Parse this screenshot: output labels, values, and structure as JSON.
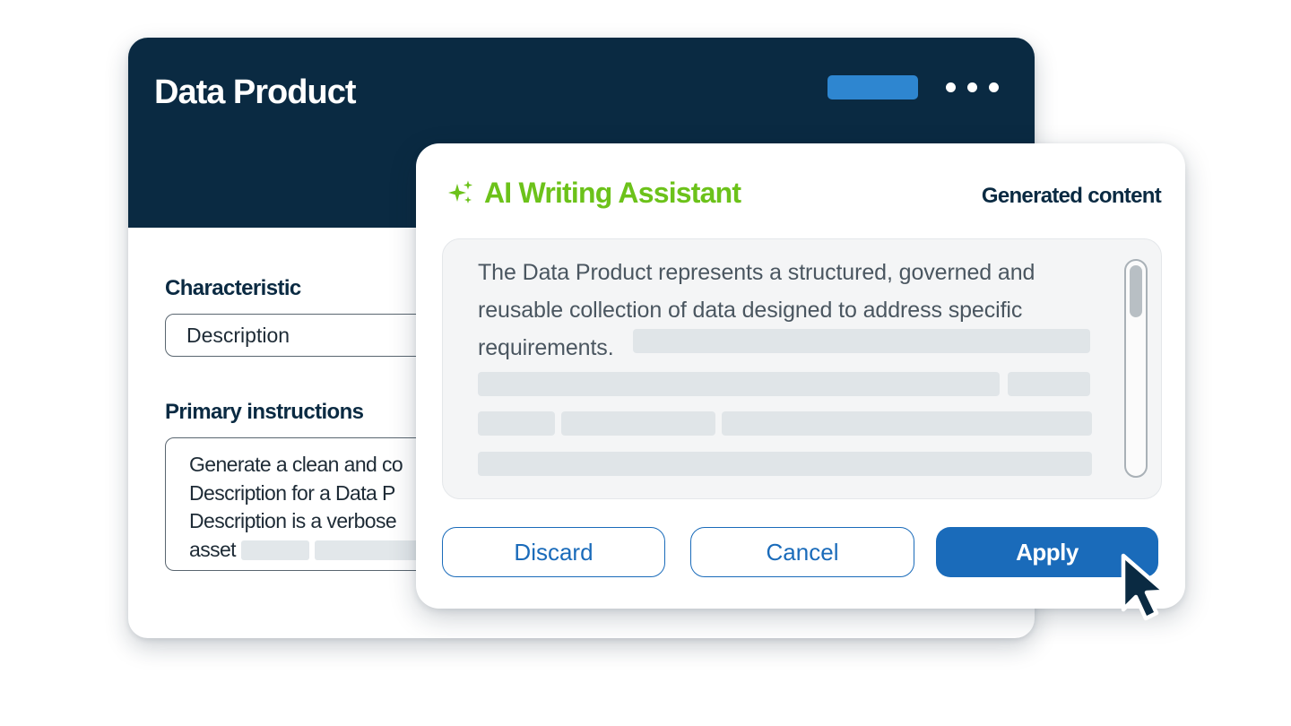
{
  "product": {
    "title": "Data Product",
    "characteristic_label": "Characteristic",
    "characteristic_value": "Description",
    "primary_label": "Primary instructions",
    "instructions_lines": [
      "Generate a clean and co",
      "Description for a Data P",
      "Description is a verbose",
      "asset"
    ]
  },
  "assistant": {
    "title": "AI Writing Assistant",
    "icon": "sparkle-icon",
    "generated_label": "Generated content",
    "generated_text": "The Data Product represents a structured, governed and reusable collection of data designed to address specific requirements.",
    "buttons": {
      "discard": "Discard",
      "cancel": "Cancel",
      "apply": "Apply"
    }
  },
  "colors": {
    "header": "#0a2a42",
    "accent_green": "#6cc21a",
    "primary_blue": "#1a6bba",
    "pill_blue": "#2e86d0"
  },
  "icons": [
    "more-dots-icon",
    "sparkle-icon",
    "cursor-icon"
  ]
}
